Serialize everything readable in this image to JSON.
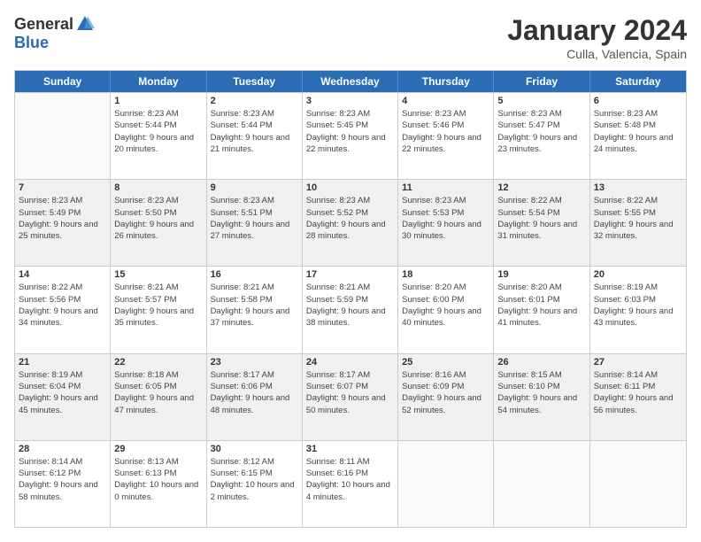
{
  "header": {
    "logo_general": "General",
    "logo_blue": "Blue",
    "month_year": "January 2024",
    "location": "Culla, Valencia, Spain"
  },
  "days_of_week": [
    "Sunday",
    "Monday",
    "Tuesday",
    "Wednesday",
    "Thursday",
    "Friday",
    "Saturday"
  ],
  "weeks": [
    [
      {
        "day": "",
        "sunrise": "",
        "sunset": "",
        "daylight": "",
        "shaded": false,
        "empty": true
      },
      {
        "day": "1",
        "sunrise": "Sunrise: 8:23 AM",
        "sunset": "Sunset: 5:44 PM",
        "daylight": "Daylight: 9 hours and 20 minutes.",
        "shaded": false,
        "empty": false
      },
      {
        "day": "2",
        "sunrise": "Sunrise: 8:23 AM",
        "sunset": "Sunset: 5:44 PM",
        "daylight": "Daylight: 9 hours and 21 minutes.",
        "shaded": false,
        "empty": false
      },
      {
        "day": "3",
        "sunrise": "Sunrise: 8:23 AM",
        "sunset": "Sunset: 5:45 PM",
        "daylight": "Daylight: 9 hours and 22 minutes.",
        "shaded": false,
        "empty": false
      },
      {
        "day": "4",
        "sunrise": "Sunrise: 8:23 AM",
        "sunset": "Sunset: 5:46 PM",
        "daylight": "Daylight: 9 hours and 22 minutes.",
        "shaded": false,
        "empty": false
      },
      {
        "day": "5",
        "sunrise": "Sunrise: 8:23 AM",
        "sunset": "Sunset: 5:47 PM",
        "daylight": "Daylight: 9 hours and 23 minutes.",
        "shaded": false,
        "empty": false
      },
      {
        "day": "6",
        "sunrise": "Sunrise: 8:23 AM",
        "sunset": "Sunset: 5:48 PM",
        "daylight": "Daylight: 9 hours and 24 minutes.",
        "shaded": false,
        "empty": false
      }
    ],
    [
      {
        "day": "7",
        "sunrise": "Sunrise: 8:23 AM",
        "sunset": "Sunset: 5:49 PM",
        "daylight": "Daylight: 9 hours and 25 minutes.",
        "shaded": true,
        "empty": false
      },
      {
        "day": "8",
        "sunrise": "Sunrise: 8:23 AM",
        "sunset": "Sunset: 5:50 PM",
        "daylight": "Daylight: 9 hours and 26 minutes.",
        "shaded": true,
        "empty": false
      },
      {
        "day": "9",
        "sunrise": "Sunrise: 8:23 AM",
        "sunset": "Sunset: 5:51 PM",
        "daylight": "Daylight: 9 hours and 27 minutes.",
        "shaded": true,
        "empty": false
      },
      {
        "day": "10",
        "sunrise": "Sunrise: 8:23 AM",
        "sunset": "Sunset: 5:52 PM",
        "daylight": "Daylight: 9 hours and 28 minutes.",
        "shaded": true,
        "empty": false
      },
      {
        "day": "11",
        "sunrise": "Sunrise: 8:23 AM",
        "sunset": "Sunset: 5:53 PM",
        "daylight": "Daylight: 9 hours and 30 minutes.",
        "shaded": true,
        "empty": false
      },
      {
        "day": "12",
        "sunrise": "Sunrise: 8:22 AM",
        "sunset": "Sunset: 5:54 PM",
        "daylight": "Daylight: 9 hours and 31 minutes.",
        "shaded": true,
        "empty": false
      },
      {
        "day": "13",
        "sunrise": "Sunrise: 8:22 AM",
        "sunset": "Sunset: 5:55 PM",
        "daylight": "Daylight: 9 hours and 32 minutes.",
        "shaded": true,
        "empty": false
      }
    ],
    [
      {
        "day": "14",
        "sunrise": "Sunrise: 8:22 AM",
        "sunset": "Sunset: 5:56 PM",
        "daylight": "Daylight: 9 hours and 34 minutes.",
        "shaded": false,
        "empty": false
      },
      {
        "day": "15",
        "sunrise": "Sunrise: 8:21 AM",
        "sunset": "Sunset: 5:57 PM",
        "daylight": "Daylight: 9 hours and 35 minutes.",
        "shaded": false,
        "empty": false
      },
      {
        "day": "16",
        "sunrise": "Sunrise: 8:21 AM",
        "sunset": "Sunset: 5:58 PM",
        "daylight": "Daylight: 9 hours and 37 minutes.",
        "shaded": false,
        "empty": false
      },
      {
        "day": "17",
        "sunrise": "Sunrise: 8:21 AM",
        "sunset": "Sunset: 5:59 PM",
        "daylight": "Daylight: 9 hours and 38 minutes.",
        "shaded": false,
        "empty": false
      },
      {
        "day": "18",
        "sunrise": "Sunrise: 8:20 AM",
        "sunset": "Sunset: 6:00 PM",
        "daylight": "Daylight: 9 hours and 40 minutes.",
        "shaded": false,
        "empty": false
      },
      {
        "day": "19",
        "sunrise": "Sunrise: 8:20 AM",
        "sunset": "Sunset: 6:01 PM",
        "daylight": "Daylight: 9 hours and 41 minutes.",
        "shaded": false,
        "empty": false
      },
      {
        "day": "20",
        "sunrise": "Sunrise: 8:19 AM",
        "sunset": "Sunset: 6:03 PM",
        "daylight": "Daylight: 9 hours and 43 minutes.",
        "shaded": false,
        "empty": false
      }
    ],
    [
      {
        "day": "21",
        "sunrise": "Sunrise: 8:19 AM",
        "sunset": "Sunset: 6:04 PM",
        "daylight": "Daylight: 9 hours and 45 minutes.",
        "shaded": true,
        "empty": false
      },
      {
        "day": "22",
        "sunrise": "Sunrise: 8:18 AM",
        "sunset": "Sunset: 6:05 PM",
        "daylight": "Daylight: 9 hours and 47 minutes.",
        "shaded": true,
        "empty": false
      },
      {
        "day": "23",
        "sunrise": "Sunrise: 8:17 AM",
        "sunset": "Sunset: 6:06 PM",
        "daylight": "Daylight: 9 hours and 48 minutes.",
        "shaded": true,
        "empty": false
      },
      {
        "day": "24",
        "sunrise": "Sunrise: 8:17 AM",
        "sunset": "Sunset: 6:07 PM",
        "daylight": "Daylight: 9 hours and 50 minutes.",
        "shaded": true,
        "empty": false
      },
      {
        "day": "25",
        "sunrise": "Sunrise: 8:16 AM",
        "sunset": "Sunset: 6:09 PM",
        "daylight": "Daylight: 9 hours and 52 minutes.",
        "shaded": true,
        "empty": false
      },
      {
        "day": "26",
        "sunrise": "Sunrise: 8:15 AM",
        "sunset": "Sunset: 6:10 PM",
        "daylight": "Daylight: 9 hours and 54 minutes.",
        "shaded": true,
        "empty": false
      },
      {
        "day": "27",
        "sunrise": "Sunrise: 8:14 AM",
        "sunset": "Sunset: 6:11 PM",
        "daylight": "Daylight: 9 hours and 56 minutes.",
        "shaded": true,
        "empty": false
      }
    ],
    [
      {
        "day": "28",
        "sunrise": "Sunrise: 8:14 AM",
        "sunset": "Sunset: 6:12 PM",
        "daylight": "Daylight: 9 hours and 58 minutes.",
        "shaded": false,
        "empty": false
      },
      {
        "day": "29",
        "sunrise": "Sunrise: 8:13 AM",
        "sunset": "Sunset: 6:13 PM",
        "daylight": "Daylight: 10 hours and 0 minutes.",
        "shaded": false,
        "empty": false
      },
      {
        "day": "30",
        "sunrise": "Sunrise: 8:12 AM",
        "sunset": "Sunset: 6:15 PM",
        "daylight": "Daylight: 10 hours and 2 minutes.",
        "shaded": false,
        "empty": false
      },
      {
        "day": "31",
        "sunrise": "Sunrise: 8:11 AM",
        "sunset": "Sunset: 6:16 PM",
        "daylight": "Daylight: 10 hours and 4 minutes.",
        "shaded": false,
        "empty": false
      },
      {
        "day": "",
        "sunrise": "",
        "sunset": "",
        "daylight": "",
        "shaded": false,
        "empty": true
      },
      {
        "day": "",
        "sunrise": "",
        "sunset": "",
        "daylight": "",
        "shaded": false,
        "empty": true
      },
      {
        "day": "",
        "sunrise": "",
        "sunset": "",
        "daylight": "",
        "shaded": false,
        "empty": true
      }
    ]
  ]
}
